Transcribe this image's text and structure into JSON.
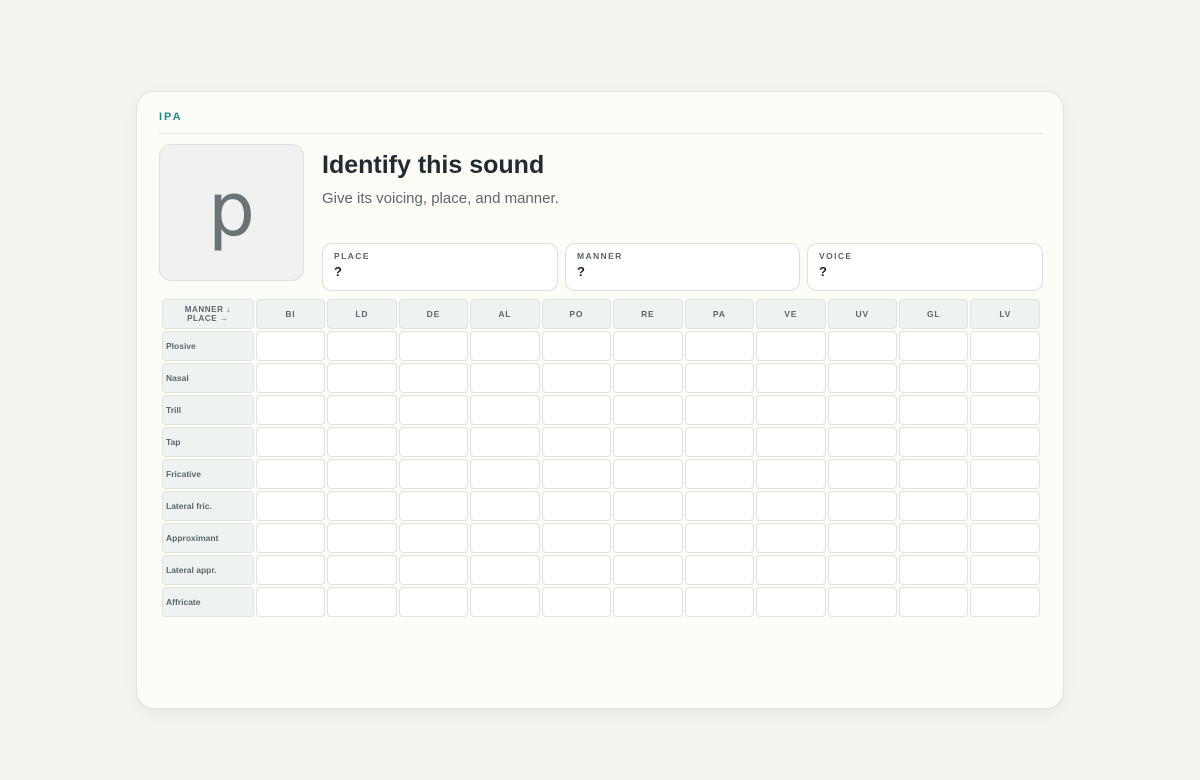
{
  "header": {
    "brand": "IPA"
  },
  "prompt": {
    "glyph": "p",
    "title": "Identify this sound",
    "subtitle": "Give its voicing, place, and manner."
  },
  "fields": [
    {
      "label": "PLACE",
      "value": "?"
    },
    {
      "label": "MANNER",
      "value": "?"
    },
    {
      "label": "VOICE",
      "value": "?"
    }
  ],
  "chart": {
    "corner_line1": "MANNER ↓",
    "corner_line2": "PLACE →",
    "columns": [
      "BI",
      "LD",
      "DE",
      "AL",
      "PO",
      "RE",
      "PA",
      "VE",
      "UV",
      "GL",
      "LV"
    ],
    "rows": [
      "Plosive",
      "Nasal",
      "Trill",
      "Tap",
      "Fricative",
      "Lateral fric.",
      "Approximant",
      "Lateral appr.",
      "Affricate"
    ]
  }
}
